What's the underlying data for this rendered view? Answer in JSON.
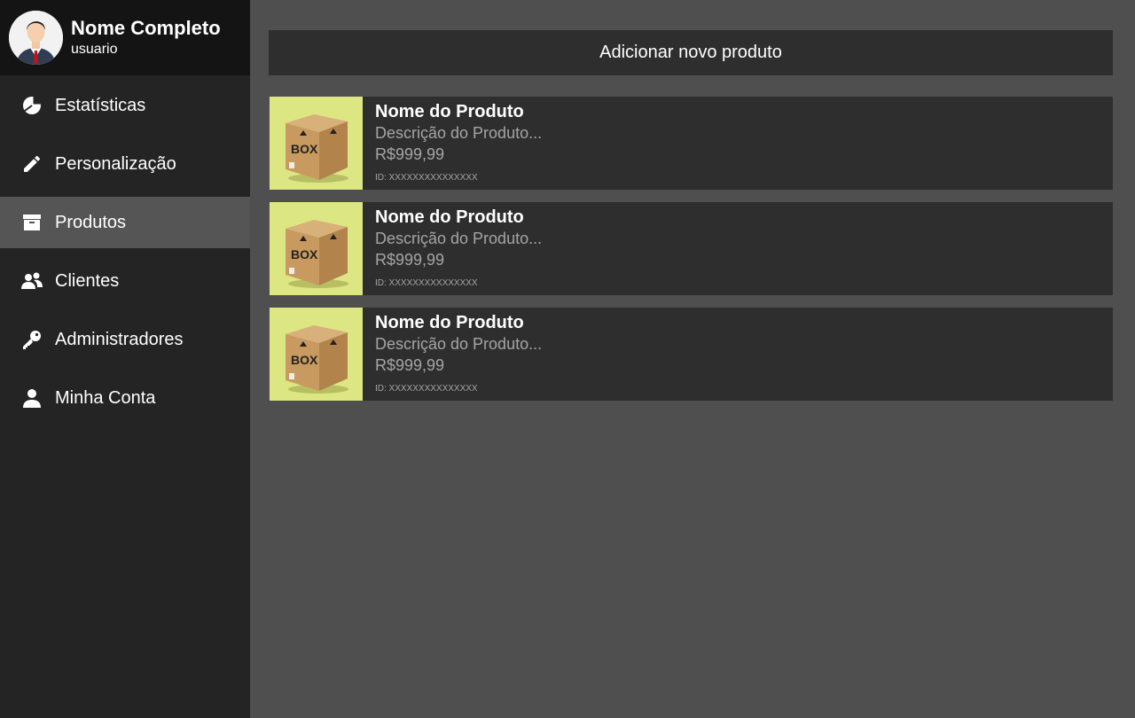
{
  "profile": {
    "name": "Nome Completo",
    "username": "usuario"
  },
  "sidebar": {
    "items": [
      {
        "label": "Estatísticas",
        "icon": "pie-chart-icon"
      },
      {
        "label": "Personalização",
        "icon": "pencil-icon"
      },
      {
        "label": "Produtos",
        "icon": "archive-icon",
        "active": true
      },
      {
        "label": "Clientes",
        "icon": "users-icon"
      },
      {
        "label": "Administradores",
        "icon": "key-icon"
      },
      {
        "label": "Minha Conta",
        "icon": "user-icon"
      }
    ]
  },
  "main": {
    "add_button_label": "Adicionar novo produto",
    "products": [
      {
        "name": "Nome do Produto",
        "description": "Descrição do Produto...",
        "price": "R$999,99",
        "id": "ID: XXXXXXXXXXXXXXX",
        "image_label": "BOX"
      },
      {
        "name": "Nome do Produto",
        "description": "Descrição do Produto...",
        "price": "R$999,99",
        "id": "ID: XXXXXXXXXXXXXXX",
        "image_label": "BOX"
      },
      {
        "name": "Nome do Produto",
        "description": "Descrição do Produto...",
        "price": "R$999,99",
        "id": "ID: XXXXXXXXXXXXXXX",
        "image_label": "BOX"
      }
    ]
  },
  "colors": {
    "page_bg": "#4f4f4f",
    "sidebar_bg": "#242424",
    "profile_bg": "#141414",
    "active_item_bg": "#555555",
    "card_bg": "#2e2e2e",
    "thumb_bg": "#dce682",
    "muted_text": "#a5a5a5"
  }
}
